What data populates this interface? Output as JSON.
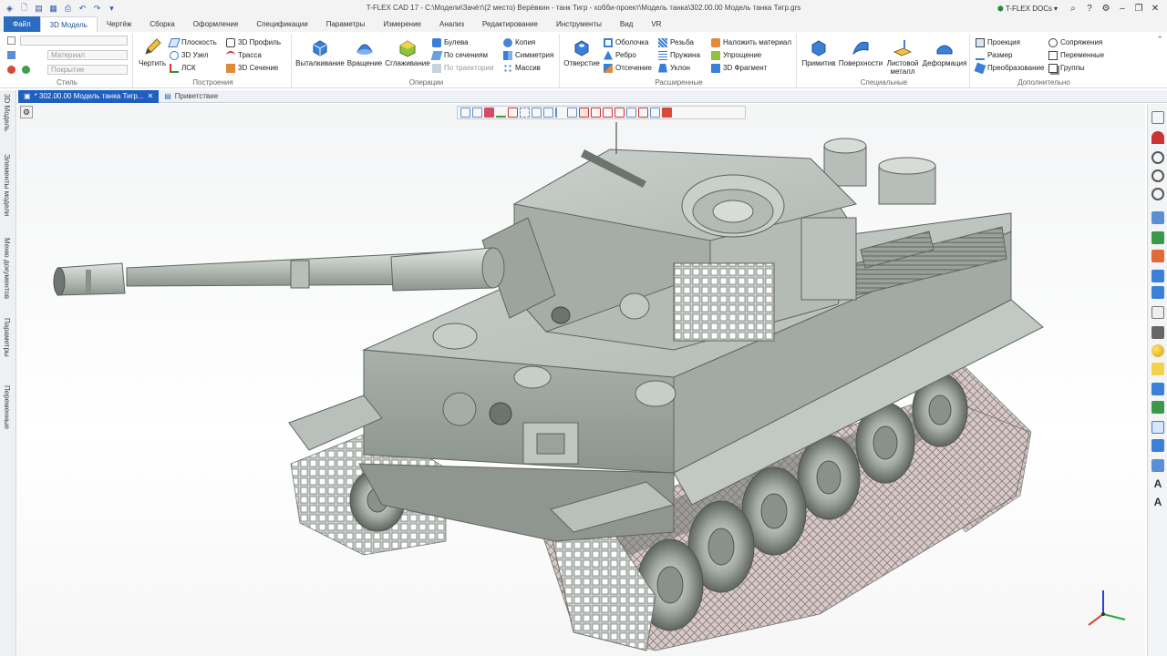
{
  "app": {
    "title": "T-FLEX CAD 17 - C:\\Модели\\Зачёт\\(2 место) Верёвкин - танк Тигр - хобби-проект\\Модель танка\\302.00.00 Модель танка Тигр.grs",
    "docs_label": "T-FLEX DOCs",
    "accent": "#2b6cbf"
  },
  "ribbon_tabs": [
    "Файл",
    "3D Модель",
    "Чертёж",
    "Сборка",
    "Оформление",
    "Спецификации",
    "Параметры",
    "Измерение",
    "Анализ",
    "Редактирование",
    "Инструменты",
    "Вид",
    "VR"
  ],
  "style_group": {
    "label": "Стиль",
    "material_placeholder": "Материал",
    "coating_placeholder": "Покрытие"
  },
  "build_group": {
    "label": "Построения",
    "draw": "Чертить",
    "items": [
      "Плоскость",
      "3D Узел",
      "ЛСК",
      "3D Профиль",
      "Трасса",
      "3D Сечение"
    ]
  },
  "ops_group": {
    "label": "Операции",
    "big": [
      "Выталкивание",
      "Вращение",
      "Сглаживание"
    ],
    "items": [
      "Булева",
      "По сечениям",
      "По траектории",
      "Копия",
      "Симметрия",
      "Массив"
    ]
  },
  "ext_group": {
    "label": "Расширенные",
    "big": [
      "Отверстие"
    ],
    "items": [
      "Оболочка",
      "Ребро",
      "Отсечение",
      "Резьба",
      "Пружина",
      "Уклон",
      "Наложить материал",
      "Упрощение",
      "3D Фрагмент"
    ]
  },
  "spec_group": {
    "label": "Специальные",
    "big": [
      "Примитив",
      "Поверхности",
      "Листовой металл",
      "Деформация"
    ]
  },
  "add_group": {
    "label": "Дополнительно",
    "items": [
      "Проекция",
      "Размер",
      "Преобразование",
      "Сопряжения",
      "Переменные",
      "Группы"
    ]
  },
  "doc_tabs": {
    "active": "* 302.00.00 Модель танка Тигр...",
    "inactive": "Приветствие"
  },
  "left_panels": [
    "3D Модель",
    "Элементы модели",
    "Меню документов",
    "Параметры",
    "Переменные"
  ]
}
